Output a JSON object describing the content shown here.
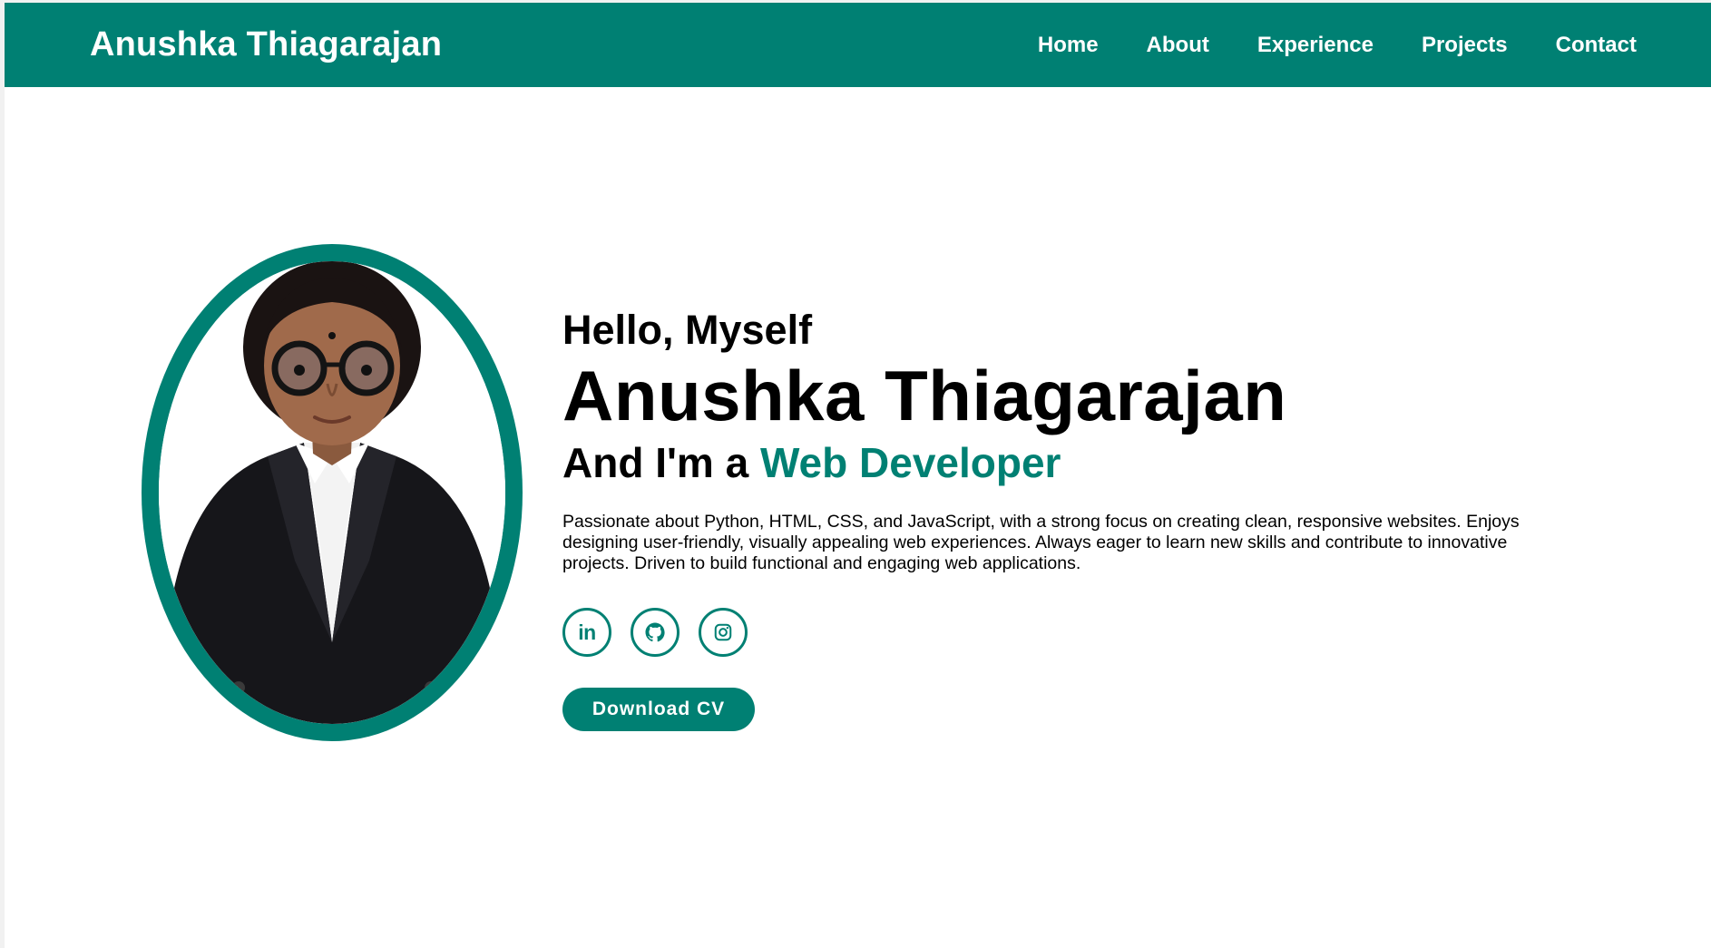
{
  "navbar": {
    "brand": "Anushka Thiagarajan",
    "links": [
      "Home",
      "About",
      "Experience",
      "Projects",
      "Contact"
    ]
  },
  "hero": {
    "greeting": "Hello, Myself",
    "name": "Anushka Thiagarajan",
    "role_prefix": "And I'm a ",
    "role": "Web Developer",
    "bio": "Passionate about Python, HTML, CSS, and JavaScript, with a strong focus on creating clean, responsive websites. Enjoys designing user-friendly, visually appealing web experiences. Always eager to learn new skills and contribute to innovative projects. Driven to build functional and engaging web applications.",
    "socials": [
      {
        "icon": "linkedin-icon",
        "text": "in"
      },
      {
        "icon": "github-icon"
      },
      {
        "icon": "instagram-icon"
      }
    ],
    "cv_button": "Download CV"
  },
  "colors": {
    "accent": "#008073",
    "nav_text": "#ffffff",
    "body_text": "#000000",
    "background": "#ffffff"
  }
}
